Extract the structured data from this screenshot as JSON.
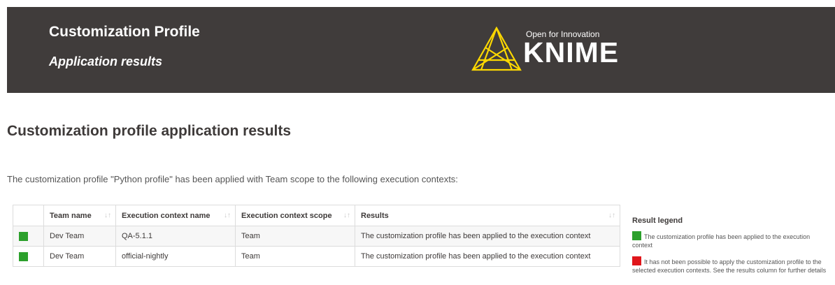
{
  "banner": {
    "title": "Customization Profile",
    "subtitle": "Application results",
    "logo_tagline": "Open for Innovation",
    "logo_word": "KNIME",
    "background_color": "#403c3b",
    "logo_color": "#fdd800"
  },
  "main": {
    "title": "Customization profile application results",
    "intro": "The customization profile \"Python profile\" has been applied with Team scope to the following execution contexts:"
  },
  "table": {
    "columns": [
      "",
      "Team name",
      "Execution context name",
      "Execution context scope",
      "Results"
    ],
    "sort_icon": "sort-arrows-icon",
    "rows": [
      {
        "status": "success",
        "status_color": "#2ca02c",
        "team": "Dev Team",
        "context": "QA-5.1.1",
        "scope": "Team",
        "result": "The customization profile has been applied to the execution context"
      },
      {
        "status": "success",
        "status_color": "#2ca02c",
        "team": "Dev Team",
        "context": "official-nightly",
        "scope": "Team",
        "result": "The customization profile has been applied to the execution context"
      }
    ]
  },
  "legend": {
    "title": "Result legend",
    "items": [
      {
        "color": "#2ca02c",
        "text": "The customization profile has been applied to the execution context"
      },
      {
        "color": "#e0161b",
        "text": "It has not been possible to apply the customization profile to the selected execution contexts. See the results column for further details"
      }
    ]
  }
}
